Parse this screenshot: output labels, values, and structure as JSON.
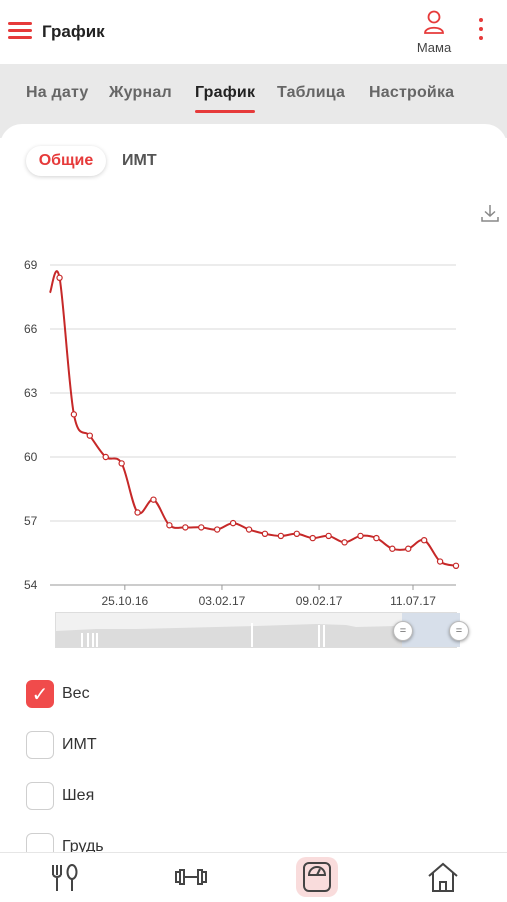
{
  "header": {
    "title": "График",
    "profile_name": "Мама",
    "accent": "#e63a3a"
  },
  "tabs": [
    {
      "label": "На дату",
      "active": false
    },
    {
      "label": "Журнал",
      "active": false
    },
    {
      "label": "График",
      "active": true
    },
    {
      "label": "Таблица",
      "active": false
    },
    {
      "label": "Настройка",
      "active": false
    }
  ],
  "subtabs": [
    {
      "label": "Общие",
      "active": true
    },
    {
      "label": "ИМТ",
      "active": false
    }
  ],
  "chart_data": {
    "type": "line",
    "title": "",
    "xlabel": "",
    "ylabel": "",
    "ylim": [
      54,
      69
    ],
    "yticks": [
      54,
      57,
      60,
      63,
      66,
      69
    ],
    "grid": true,
    "legend": "none",
    "line_color": "#c62828",
    "x_tick_labels": [
      "25.10.16",
      "03.02.17",
      "09.02.17",
      "11.07.17"
    ],
    "x_tick_index": [
      4.7,
      10.8,
      16.9,
      22.8
    ],
    "series": [
      {
        "x": [
          0,
          0.6,
          1.5,
          2.5,
          3.5,
          4.5,
          5.5,
          6.5,
          7.5,
          8.5,
          9.5,
          10.5,
          11.5,
          12.5,
          13.5,
          14.5,
          15.5,
          16.5,
          17.5,
          18.5,
          19.5,
          20.5,
          21.5,
          22.5,
          23.5,
          24.5,
          25.5
        ],
        "values": [
          67.7,
          68.4,
          62.0,
          61.0,
          60.0,
          59.7,
          57.4,
          58.0,
          56.8,
          56.7,
          56.7,
          56.6,
          56.9,
          56.6,
          56.4,
          56.3,
          56.4,
          56.2,
          56.3,
          56.0,
          56.3,
          56.2,
          55.7,
          55.7,
          56.1,
          55.1,
          54.9
        ]
      }
    ]
  },
  "checkboxes": [
    {
      "label": "Вес",
      "checked": true
    },
    {
      "label": "ИМТ",
      "checked": false
    },
    {
      "label": "Шея",
      "checked": false
    },
    {
      "label": "Грудь",
      "checked": false
    }
  ],
  "bottom_nav": [
    {
      "icon": "fork-spoon-icon",
      "active": false
    },
    {
      "icon": "dumbbell-icon",
      "active": false
    },
    {
      "icon": "scale-icon",
      "active": true
    },
    {
      "icon": "home-icon",
      "active": false
    }
  ]
}
